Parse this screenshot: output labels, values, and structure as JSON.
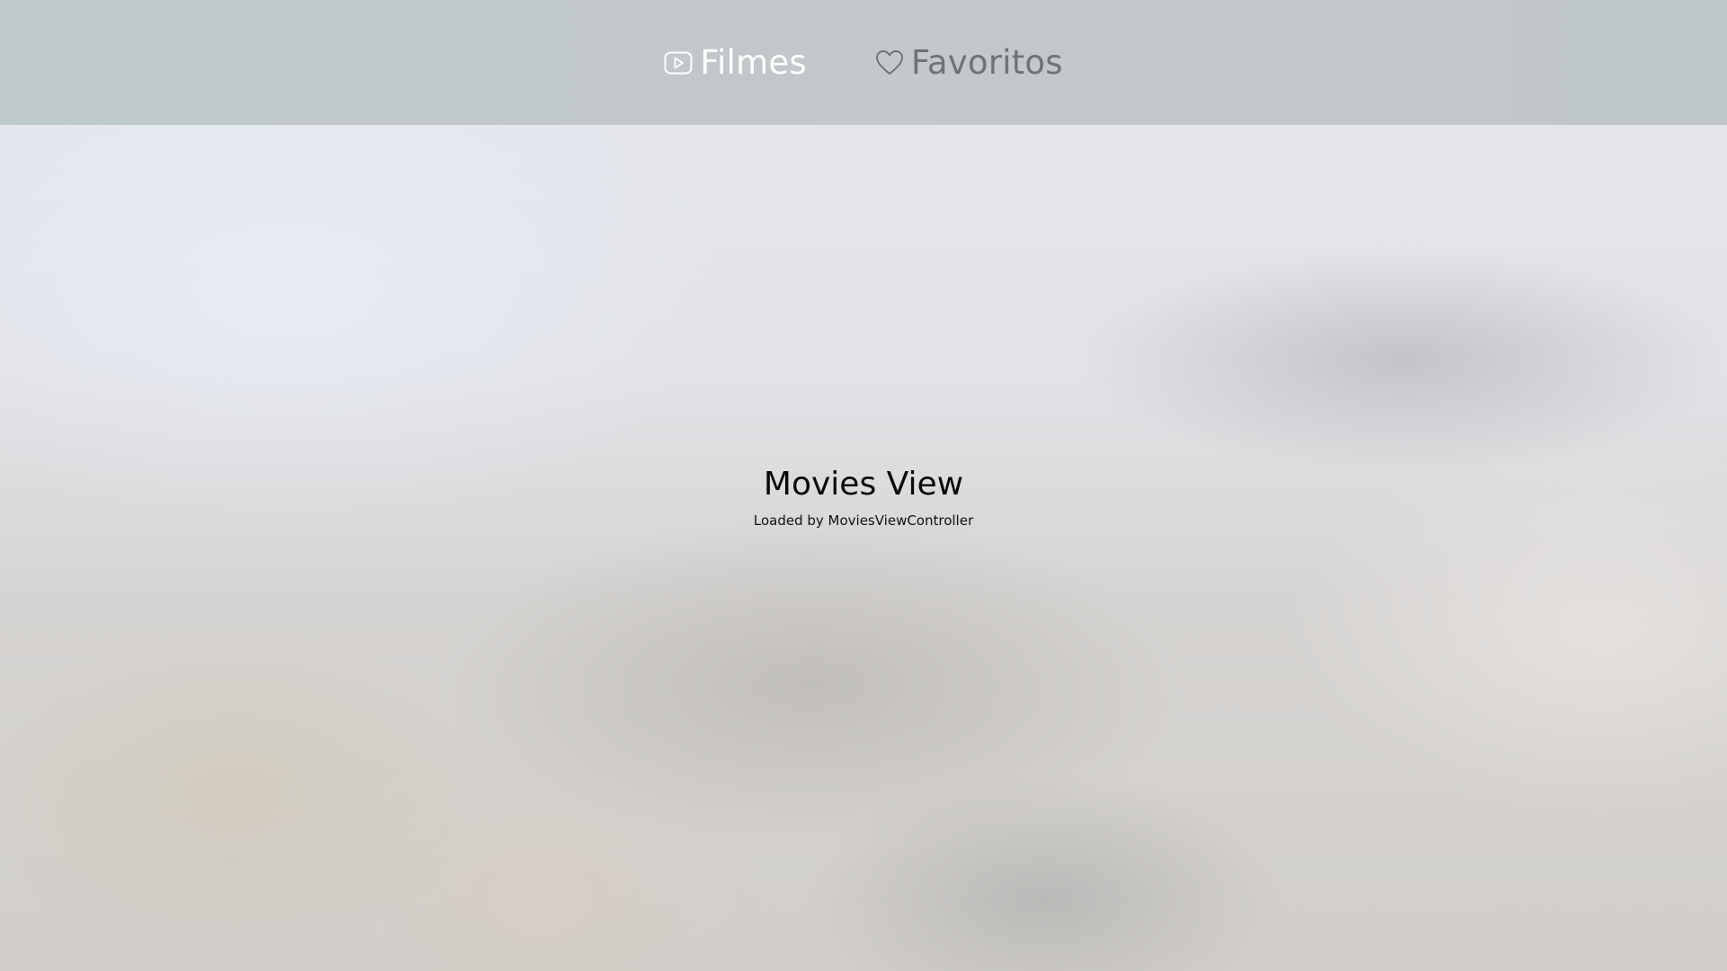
{
  "tabbar": {
    "tabs": [
      {
        "label": "Filmes",
        "icon": "play-rectangle-icon",
        "selected": true
      },
      {
        "label": "Favoritos",
        "icon": "heart-icon",
        "selected": false
      }
    ]
  },
  "main": {
    "title": "Movies View",
    "subtitle": "Loaded by MoviesViewController"
  },
  "colors": {
    "selected_tab": "#ffffff",
    "unselected_tab": "#6f7375",
    "tabbar_background": "#c1c8ca"
  }
}
